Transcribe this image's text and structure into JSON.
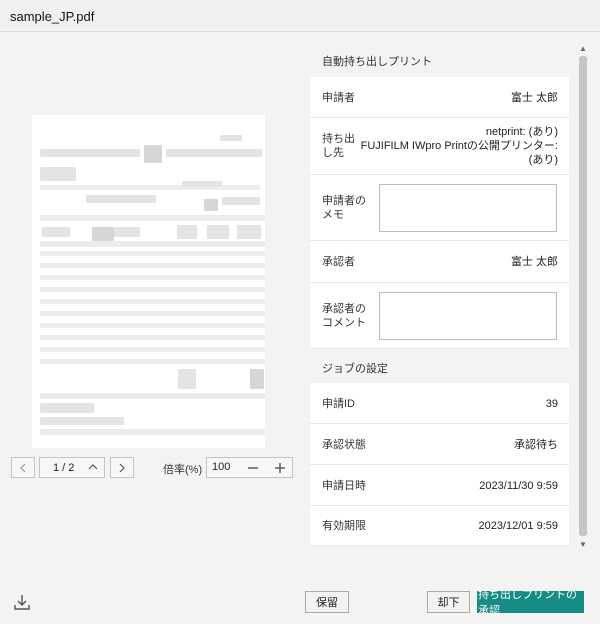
{
  "window": {
    "title": "sample_JP.pdf"
  },
  "viewer": {
    "page_indicator": "1 / 2",
    "zoom_label": "倍率(%)",
    "zoom_value": "100"
  },
  "details": {
    "section_auto": "自動持ち出しプリント",
    "applicant_label": "申請者",
    "applicant_value": "富士 太郎",
    "destination_label": "持ち出し先",
    "destination_value_line1": "netprint: (あり)",
    "destination_value_line2": "FUJIFILM IWpro Printの公開プリンター:",
    "destination_value_line3": "(あり)",
    "applicant_memo_label_line1": "申請者の",
    "applicant_memo_label_line2": "メモ",
    "applicant_memo_value": "",
    "approver_label": "承認者",
    "approver_value": "富士 太郎",
    "approver_comment_label_line1": "承認者の",
    "approver_comment_label_line2": "コメント",
    "approver_comment_value": "",
    "section_job": "ジョブの設定",
    "request_id_label": "申請ID",
    "request_id_value": "39",
    "status_label": "承認状態",
    "status_value": "承認待ち",
    "date_label": "申請日時",
    "date_value": "2023/11/30 9:59",
    "expiry_label": "有効期限",
    "expiry_value": "2023/12/01 9:59"
  },
  "footer": {
    "hold_label": "保留",
    "reject_label": "却下",
    "approve_label": "持ち出しプリントの承認"
  },
  "colors": {
    "primary": "#178c87"
  },
  "icons": [
    "chevron-left-icon",
    "chevron-up-icon",
    "chevron-right-icon",
    "minus-icon",
    "plus-icon",
    "download-icon"
  ]
}
